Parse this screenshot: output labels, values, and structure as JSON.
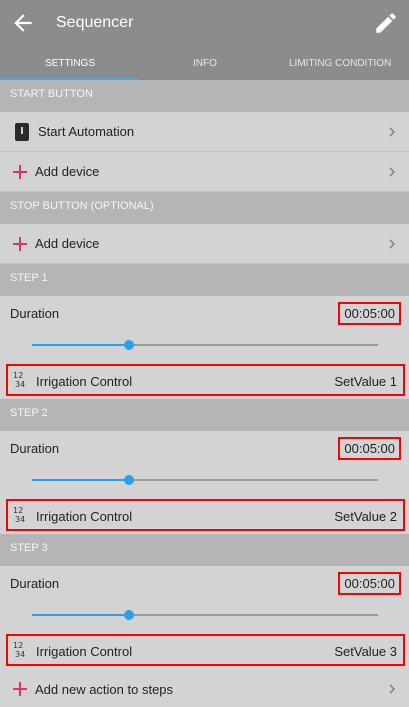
{
  "appbar": {
    "title": "Sequencer"
  },
  "tabs": [
    {
      "label": "SETTINGS"
    },
    {
      "label": "INFO"
    },
    {
      "label": "LIMITING CONDITION"
    }
  ],
  "sections": {
    "start_button": "START BUTTON",
    "stop_button": "STOP BUTTON (OPTIONAL)",
    "step1": "STEP 1",
    "step2": "STEP 2",
    "step3": "STEP 3"
  },
  "rows": {
    "start_automation": "Start Automation",
    "add_device": "Add device",
    "add_new_action": "Add new action to steps"
  },
  "steps": [
    {
      "duration_label": "Duration",
      "duration_value": "00:05:00",
      "slider_fraction": 0.28,
      "action_label": "Irrigation Control",
      "action_value": "SetValue 1"
    },
    {
      "duration_label": "Duration",
      "duration_value": "00:05:00",
      "slider_fraction": 0.28,
      "action_label": "Irrigation Control",
      "action_value": "SetValue 2"
    },
    {
      "duration_label": "Duration",
      "duration_value": "00:05:00",
      "slider_fraction": 0.28,
      "action_label": "Irrigation Control",
      "action_value": "SetValue 3"
    }
  ],
  "icons": {
    "back": "back-arrow-icon",
    "edit": "pencil-icon",
    "device": "device-icon",
    "plus": "plus-icon",
    "number": "numbers-1234-icon",
    "chevron": "chevron-right-icon"
  },
  "colors": {
    "appbar": "#8c8c8c",
    "section": "#b5b5b5",
    "row": "#d3d3d3",
    "accent_plus": "#e0336b",
    "slider": "#2f9ee8",
    "highlight_box": "#ff0000"
  }
}
